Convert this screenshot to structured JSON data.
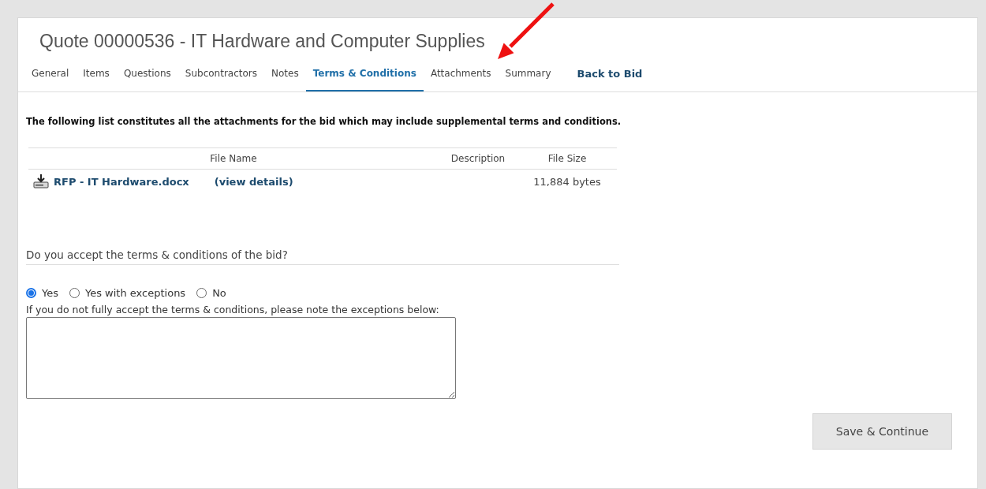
{
  "title": "Quote 00000536 - IT Hardware and Computer Supplies",
  "tabs": [
    {
      "label": "General",
      "selected": false
    },
    {
      "label": "Items",
      "selected": false
    },
    {
      "label": "Questions",
      "selected": false
    },
    {
      "label": "Subcontractors",
      "selected": false
    },
    {
      "label": "Notes",
      "selected": false
    },
    {
      "label": "Terms & Conditions",
      "selected": true
    },
    {
      "label": "Attachments",
      "selected": false
    },
    {
      "label": "Summary",
      "selected": false
    }
  ],
  "back_link": "Back to Bid",
  "intro": "The following list constitutes all the attachments for the bid which may include supplemental terms and conditions.",
  "attachments": {
    "columns": [
      "File Name",
      "Description",
      "File Size"
    ],
    "rows": [
      {
        "file": "RFP - IT Hardware.docx",
        "details": "(view details)",
        "size": "11,884 bytes"
      }
    ]
  },
  "question": "Do you accept the terms & conditions of the bid?",
  "options": [
    {
      "label": "Yes",
      "selected": true
    },
    {
      "label": "Yes with exceptions",
      "selected": false
    },
    {
      "label": "No",
      "selected": false
    }
  ],
  "exceptions_label": "If you do not fully accept the terms & conditions, please note the exceptions below:",
  "save_button": "Save & Continue"
}
